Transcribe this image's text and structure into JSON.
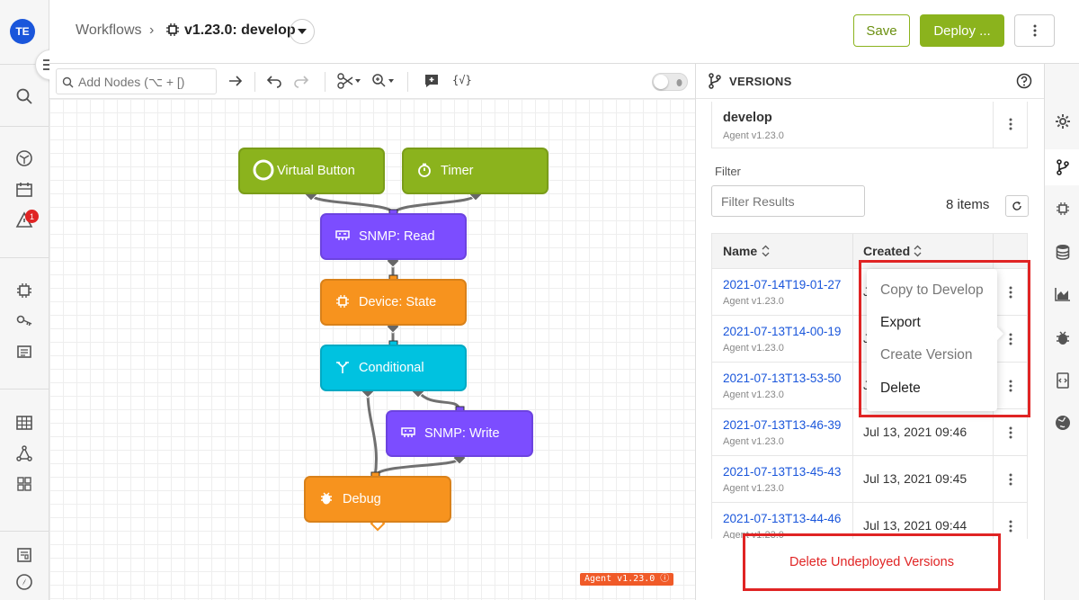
{
  "user": {
    "initials": "TE"
  },
  "nav": {
    "alert_count": "1"
  },
  "header": {
    "breadcrumb": "Workflows",
    "separator": "›",
    "workflow_title": "v1.23.0: develop",
    "save_label": "Save",
    "deploy_label": "Deploy ..."
  },
  "toolbar": {
    "search_placeholder": "Add Nodes (⌥ + [)",
    "expression_label": "{√}"
  },
  "nodes": [
    {
      "label": "Virtual Button",
      "icon": "circle-icon",
      "color": "#8bb31d"
    },
    {
      "label": "Timer",
      "icon": "stopwatch-icon",
      "color": "#8bb31d"
    },
    {
      "label": "SNMP: Read",
      "icon": "snmp-icon",
      "color": "#7c4dff"
    },
    {
      "label": "Device: State",
      "icon": "chip-icon",
      "color": "#f7931e"
    },
    {
      "label": "Conditional",
      "icon": "branch-icon",
      "color": "#00c2e0"
    },
    {
      "label": "SNMP: Write",
      "icon": "snmp-icon",
      "color": "#7c4dff"
    },
    {
      "label": "Debug",
      "icon": "bug-icon",
      "color": "#f7931e"
    }
  ],
  "canvas": {
    "version_tag": "Agent v1.23.0 ⓘ"
  },
  "panel": {
    "title": "VERSIONS",
    "current": {
      "name": "develop",
      "agent": "Agent v1.23.0"
    },
    "filter_label": "Filter",
    "filter_placeholder": "Filter Results",
    "item_count": "8 items",
    "columns": {
      "name": "Name",
      "created": "Created"
    },
    "versions": [
      {
        "name": "2021-07-14T19-01-27",
        "agent": "Agent v1.23.0",
        "created": "J"
      },
      {
        "name": "2021-07-13T14-00-19",
        "agent": "Agent v1.23.0",
        "created": "J"
      },
      {
        "name": "2021-07-13T13-53-50",
        "agent": "Agent v1.23.0",
        "created": "J"
      },
      {
        "name": "2021-07-13T13-46-39",
        "agent": "Agent v1.23.0",
        "created": "Jul 13, 2021 09:46"
      },
      {
        "name": "2021-07-13T13-45-43",
        "agent": "Agent v1.23.0",
        "created": "Jul 13, 2021 09:45"
      },
      {
        "name": "2021-07-13T13-44-46",
        "agent": "Agent v1.23.0",
        "created": "Jul 13, 2021 09:44"
      }
    ],
    "context_menu": [
      "Copy to Develop",
      "Export",
      "Create Version",
      "Delete"
    ],
    "delete_undeployed_label": "Delete Undeployed Versions"
  },
  "colors": {
    "accent_green": "#8bb31d",
    "highlight_red": "#e02424",
    "link_blue": "#1a56db"
  }
}
